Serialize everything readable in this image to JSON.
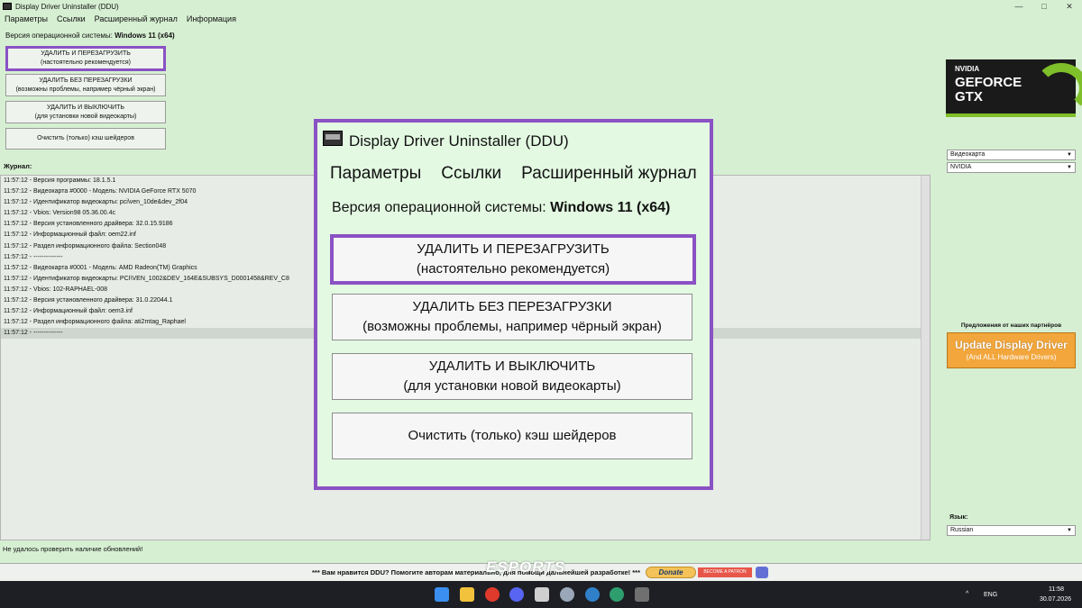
{
  "window": {
    "title": "Display Driver Uninstaller (DDU)",
    "controls": [
      "—",
      "□",
      "✕"
    ]
  },
  "menu": [
    "Параметры",
    "Ссылки",
    "Расширенный журнал",
    "Информация"
  ],
  "os": {
    "label": "Версия операционной системы:",
    "value": "Windows 11 (x64)"
  },
  "buttons": [
    {
      "line1": "УДАЛИТЬ И ПЕРЕЗАГРУЗИТЬ",
      "line2": "(настоятельно рекомендуется)"
    },
    {
      "line1": "УДАЛИТЬ БЕЗ ПЕРЕЗАГРУЗКИ",
      "line2": "(возможны проблемы, например чёрный экран)"
    },
    {
      "line1": "УДАЛИТЬ И ВЫКЛЮЧИТЬ",
      "line2": "(для установки новой видеокарты)"
    },
    {
      "line1": "Очистить (только) кэш шейдеров",
      "line2": ""
    }
  ],
  "journal": {
    "label": "Журнал:",
    "lines": [
      "11:57:12 - Версия программы: 18.1.5.1",
      "11:57:12 - Видеокарта #0000 - Модель: NVIDIA GeForce RTX 5070",
      "11:57:12 - Идентификатор видеокарты: pci\\ven_10de&dev_2f04",
      "11:57:12 - Vbios: Version98 05.36.00.4c",
      "11:57:12 - Версия установленного драйвера: 32.0.15.9186",
      "11:57:12 - Информационный файл: oem22.inf",
      "11:57:12 - Раздел информационного файла: Section048",
      "11:57:12 - --------------",
      "11:57:12 - Видеокарта #0001 - Модель: AMD Radeon(TM) Graphics",
      "11:57:12 - Идентификатор видеокарты: PCI\\VEN_1002&DEV_164E&SUBSYS_D0001458&REV_C8",
      "11:57:12 - Vbios: 102-RAPHAEL-008",
      "11:57:12 - Версия установленного драйвера: 31.0.22044.1",
      "11:57:12 - Информационный файл: oem3.inf",
      "11:57:12 - Раздел информационного файла: ati2mtag_Raphael",
      "11:57:12 - --------------"
    ]
  },
  "status": "Не удалось проверить наличие обновлений!",
  "bottom": {
    "message": "*** Вам нравится DDU? Помогите авторам материально, для помощи дальнейшей разработке! ***",
    "donate": "Donate",
    "patreon": "BECOME A PATRON",
    "watermark": "ESPORTS"
  },
  "right": {
    "logo": {
      "brand": "NVIDIA",
      "line1": "GEFORCE",
      "line2": "GTX"
    },
    "device_type": "Видеокарта",
    "vendor": "NVIDIA",
    "partners": "Предложения от наших партнёров",
    "ad_title": "Update Display Driver",
    "ad_sub": "(And ALL Hardware Drivers)",
    "language_label": "Язык:",
    "language": "Russian"
  },
  "taskbar": {
    "lang": "ENG",
    "time": "11:58",
    "date": "30.07.2026",
    "icon_colors": [
      "#3b8ff0",
      "#f2c23c",
      "#e03a2c",
      "#5865f2",
      "#cfcfcf",
      "#9aa7b8",
      "#2f80c8",
      "#2e9e6e",
      "#707070"
    ]
  }
}
